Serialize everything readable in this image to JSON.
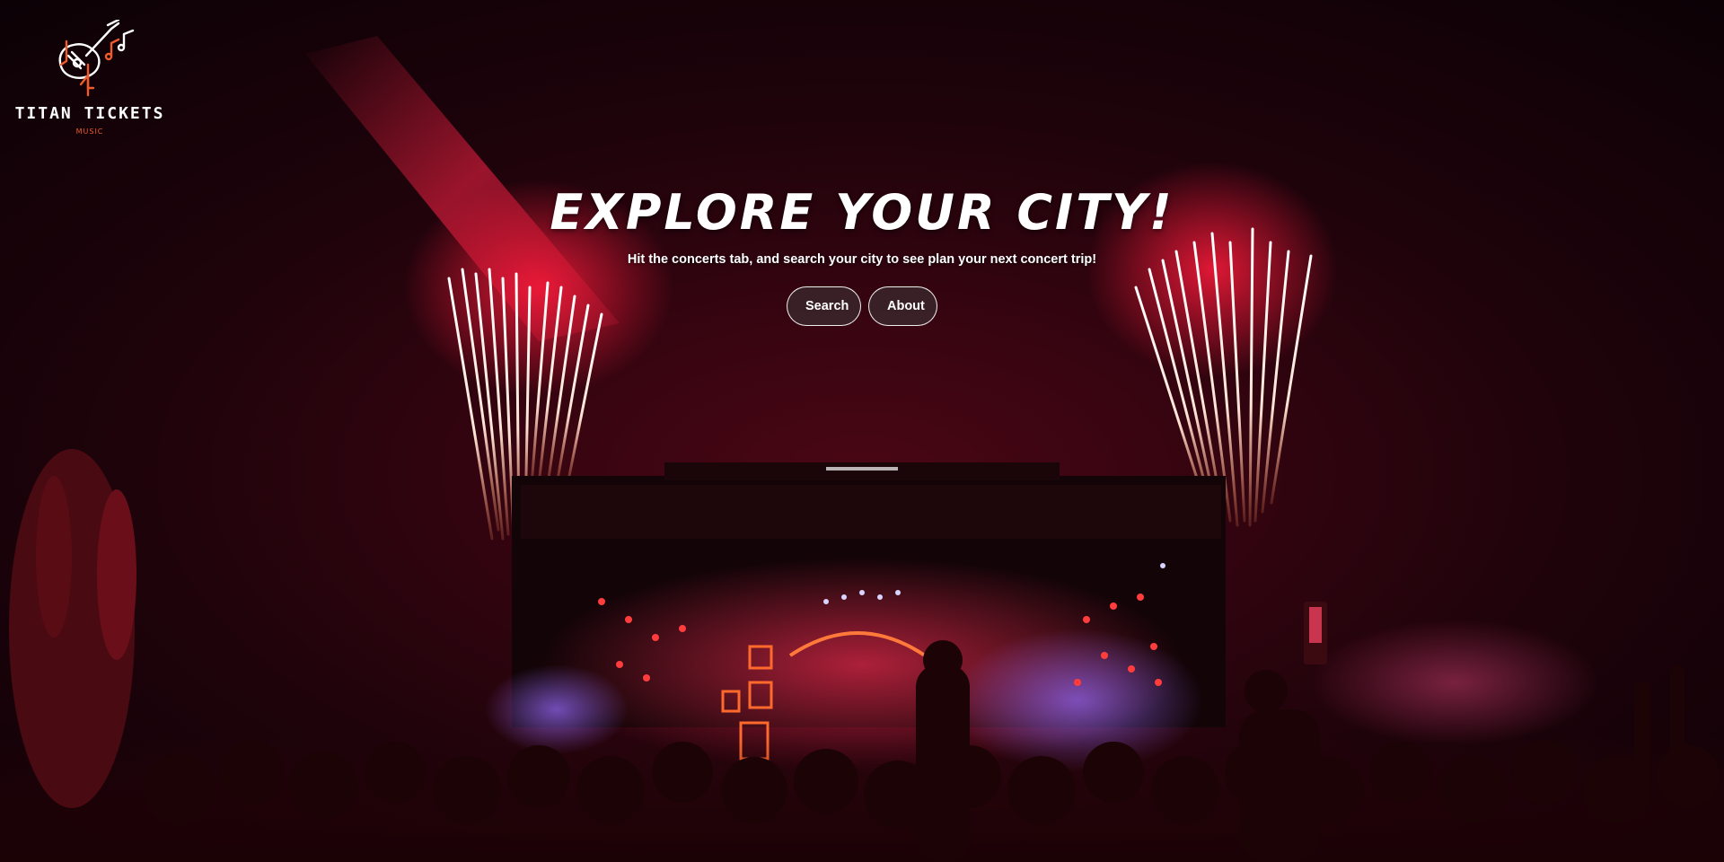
{
  "brand": {
    "name": "TITAN TICKETS",
    "tagline": "MUSIC",
    "colors": {
      "primary": "#ffffff",
      "accent": "#ef5b2a"
    },
    "logo_icon": "guitar-music-notes-icon"
  },
  "hero": {
    "title": "EXPLORE YOUR CITY!",
    "subtitle": "Hit the concerts tab, and search your city to see plan your next concert trip!",
    "buttons": [
      {
        "label": "Search"
      },
      {
        "label": "About"
      }
    ],
    "background": "concert-crowd-fireworks-photo",
    "background_colors": {
      "sky": "#14020a",
      "glow": "#d8102e",
      "stage_light": "#ff3a3a",
      "spotlight": "#8a7cff"
    }
  }
}
